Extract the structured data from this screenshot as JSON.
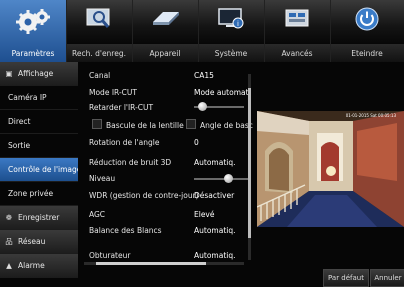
{
  "top_tabs": [
    {
      "label": "Paramètres",
      "icon": "gears-icon"
    },
    {
      "label": "Rech. d'enreg.",
      "icon": "search-icon"
    },
    {
      "label": "Appareil",
      "icon": "hard-drive-icon"
    },
    {
      "label": "Système",
      "icon": "system-monitor-icon"
    },
    {
      "label": "Avancés",
      "icon": "advanced-icon"
    },
    {
      "label": "Eteindre",
      "icon": "power-icon"
    }
  ],
  "left_menu": [
    {
      "label": "Affichage",
      "group": true,
      "icon": "display-icon"
    },
    {
      "label": "Caméra IP"
    },
    {
      "label": "Direct"
    },
    {
      "label": "Sortie"
    },
    {
      "label": "Contrôle de l'image",
      "selected": true
    },
    {
      "label": "Zone privée"
    },
    {
      "label": "Enregistrer",
      "group": true,
      "icon": "record-icon"
    },
    {
      "label": "Réseau",
      "group": true,
      "icon": "network-icon"
    },
    {
      "label": "Alarme",
      "group": true,
      "icon": "alarm-icon"
    }
  ],
  "settings": {
    "canal": {
      "label": "Canal",
      "value": "CA15"
    },
    "ircut_mode": {
      "label": "Mode IR-CUT",
      "value": "Mode automati"
    },
    "ircut_delay": {
      "label": "Retarder l'IR-CUT"
    },
    "flip": {
      "label": "Bascule de la lentille"
    },
    "angle_flip": {
      "label": "Angle de basc"
    },
    "rotation": {
      "label": "Rotation de l'angle",
      "value": "0"
    },
    "noise": {
      "label": "Réduction de bruit 3D",
      "value": "Automatiq."
    },
    "level": {
      "label": "Niveau"
    },
    "wdr": {
      "label": "WDR (gestion de contre-jour)",
      "value": "Désactiver"
    },
    "agc": {
      "label": "AGC",
      "value": "Elevé"
    },
    "white_balance": {
      "label": "Balance des Blancs",
      "value": "Automatiq."
    },
    "shutter": {
      "label": "Obturateur",
      "value": "Automatiq."
    }
  },
  "preview": {
    "osd": "01-01-2015 Sat 00:05:13"
  },
  "buttons": {
    "default": "Par défaut",
    "cancel": "Annuler"
  },
  "colors": {
    "accent": "#2f6bb4",
    "background": "#060606"
  }
}
